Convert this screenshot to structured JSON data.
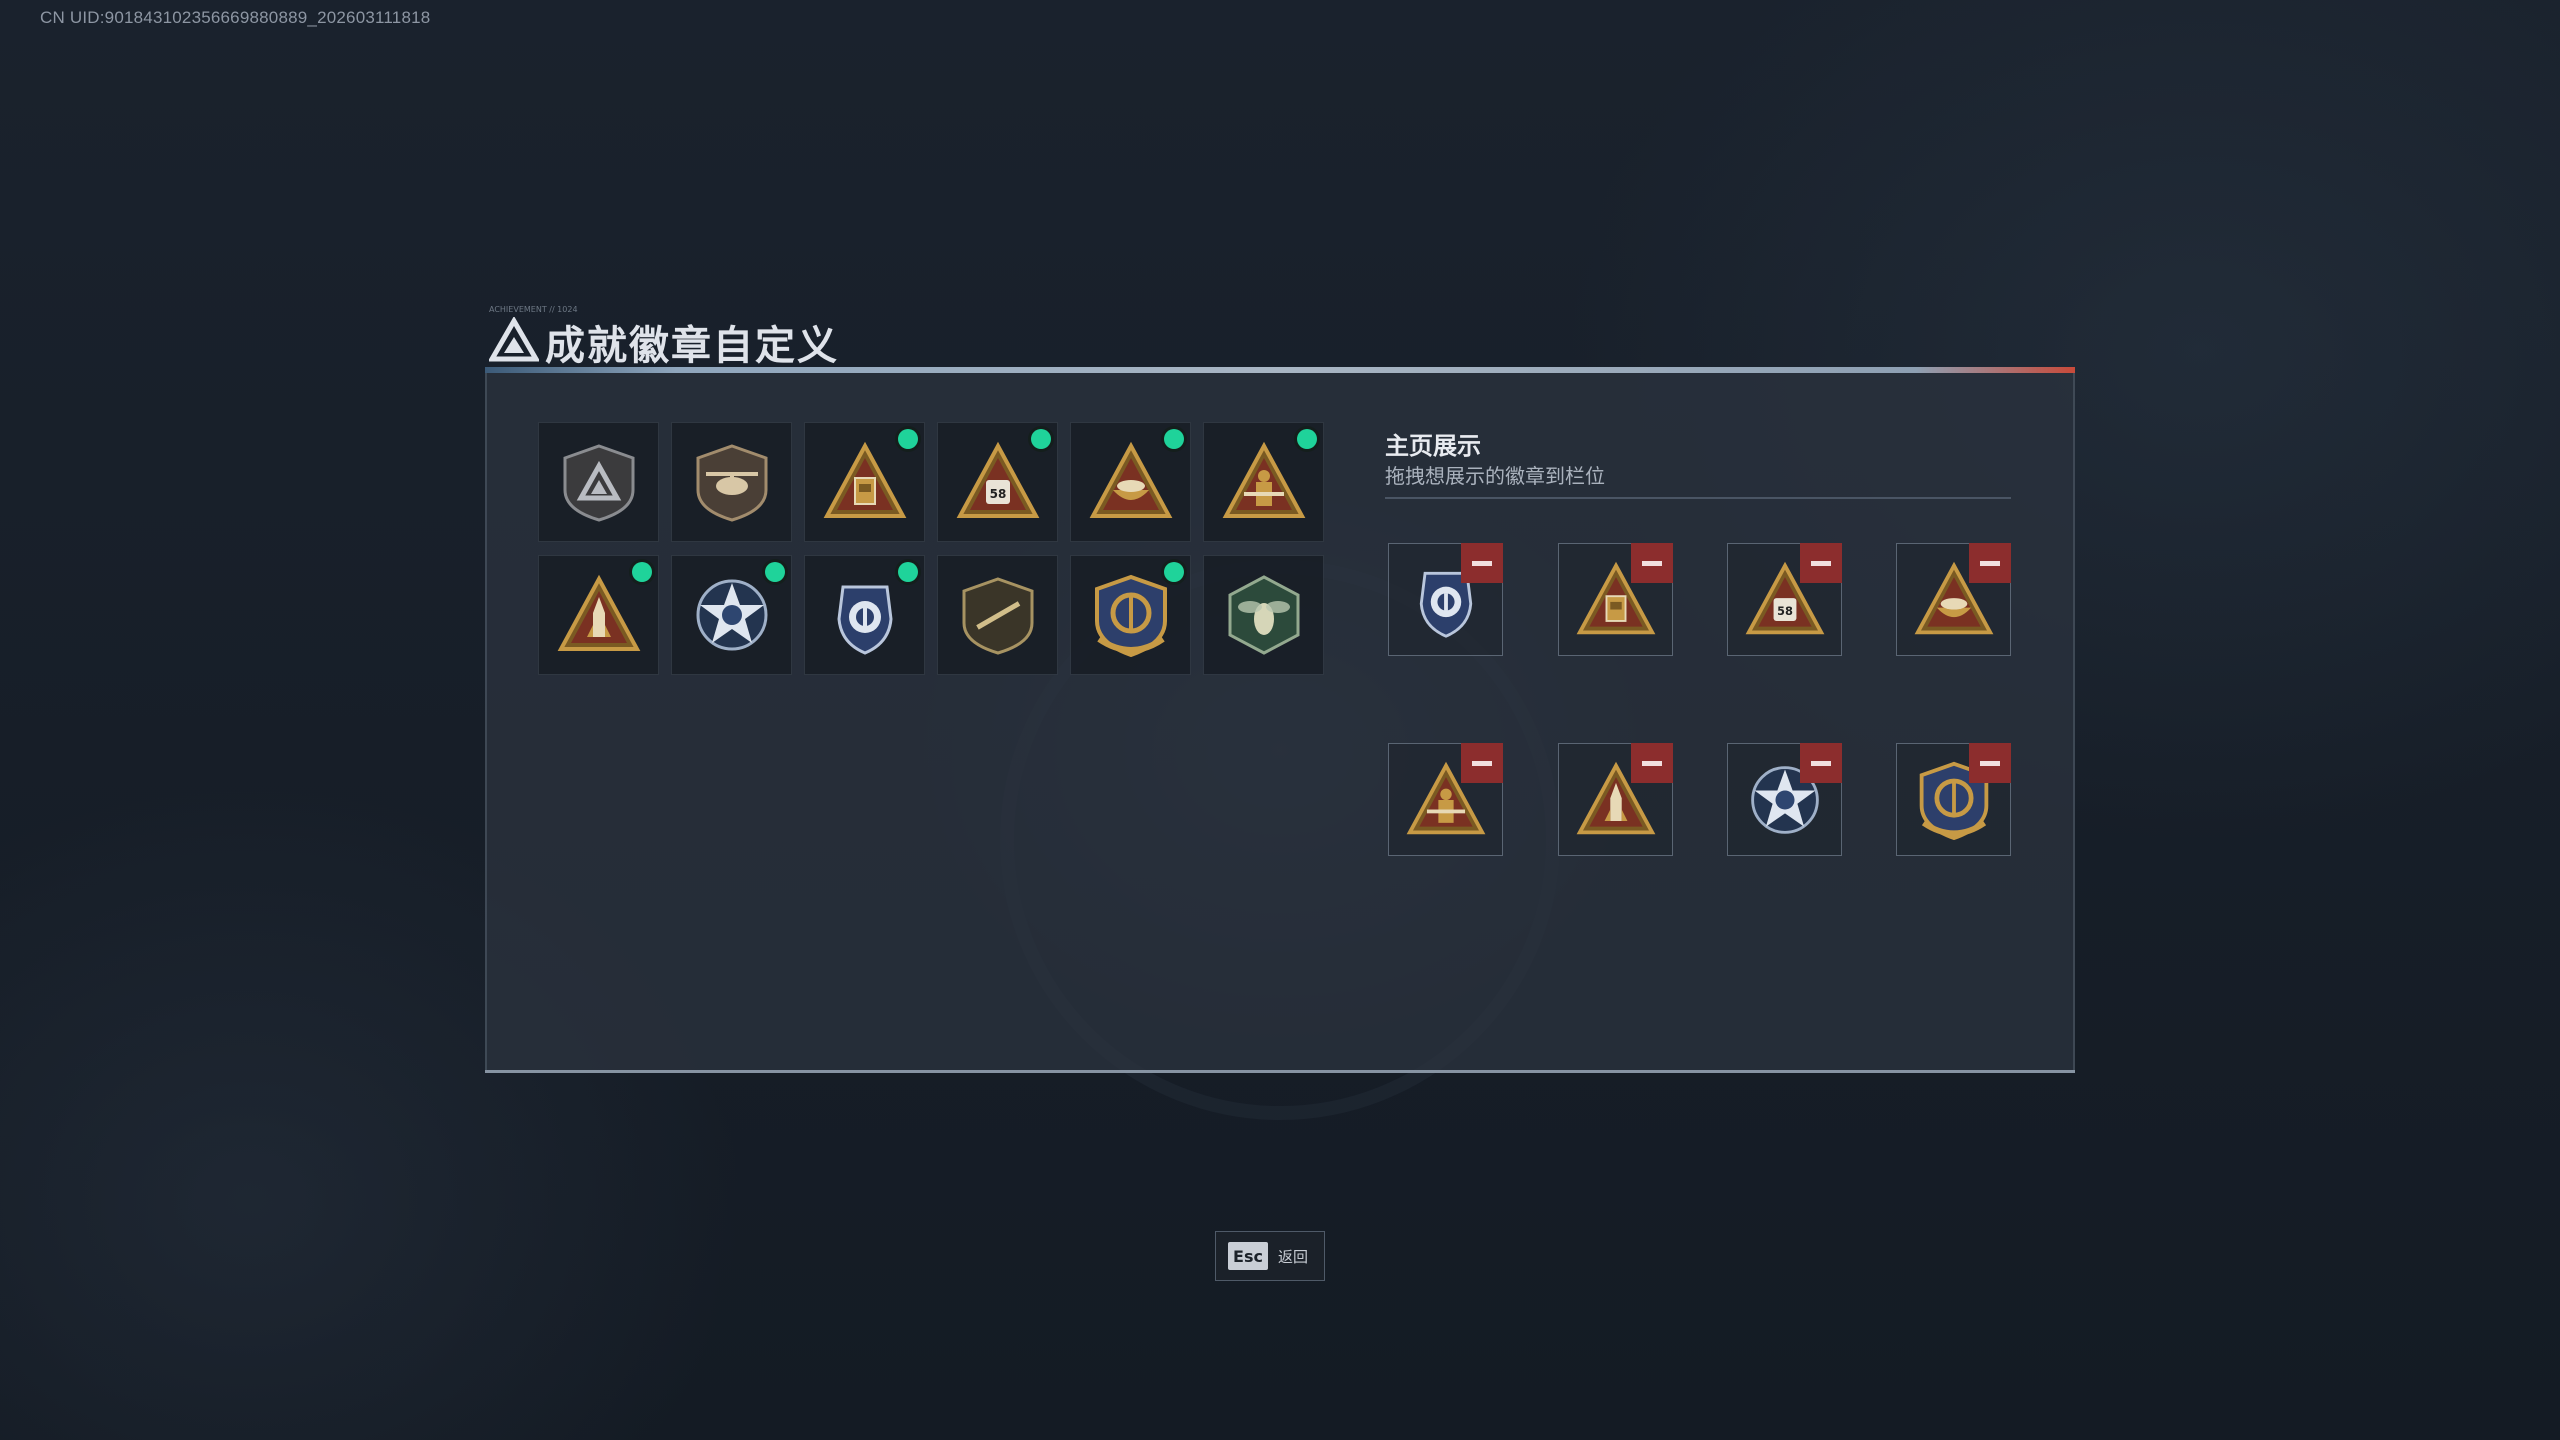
{
  "uid": "CN UID:901843102356669880889_202603111818",
  "header": {
    "tag": "ACHIEVEMENT // 1024",
    "title": "成就徽章自定义"
  },
  "badges": [
    {
      "name": "delta-badge",
      "new": false,
      "kind": "shield-dark"
    },
    {
      "name": "helicopter-badge",
      "new": false,
      "kind": "shield-heli"
    },
    {
      "name": "relic-badge",
      "new": true,
      "kind": "tri-gold"
    },
    {
      "name": "card-58-badge",
      "new": true,
      "kind": "tri-58"
    },
    {
      "name": "bowl-badge",
      "new": true,
      "kind": "tri-bowl"
    },
    {
      "name": "soldier-badge",
      "new": true,
      "kind": "tri-soldier"
    },
    {
      "name": "rocket-badge",
      "new": true,
      "kind": "tri-rocket"
    },
    {
      "name": "star-eagle-badge",
      "new": true,
      "kind": "star-blue"
    },
    {
      "name": "police-badge",
      "new": true,
      "kind": "police"
    },
    {
      "name": "rifle-badge",
      "new": false,
      "kind": "shield-rifle"
    },
    {
      "name": "anchor-badge",
      "new": true,
      "kind": "anchor-gold"
    },
    {
      "name": "hornet-badge",
      "new": false,
      "kind": "hex-hornet"
    }
  ],
  "showcase": {
    "title": "主页展示",
    "subtitle": "拖拽想展示的徽章到栏位",
    "slots": [
      {
        "kind": "police"
      },
      {
        "kind": "tri-gold"
      },
      {
        "kind": "tri-58"
      },
      {
        "kind": "tri-bowl"
      },
      {
        "kind": "tri-soldier"
      },
      {
        "kind": "tri-rocket"
      },
      {
        "kind": "star-blue"
      },
      {
        "kind": "anchor-gold"
      }
    ]
  },
  "footer": {
    "esc_key": "Esc",
    "esc_label": "返回"
  },
  "colors": {
    "accent_green": "#1fd39a",
    "remove_red": "#8c2d2d",
    "gold": "#c79a45"
  }
}
